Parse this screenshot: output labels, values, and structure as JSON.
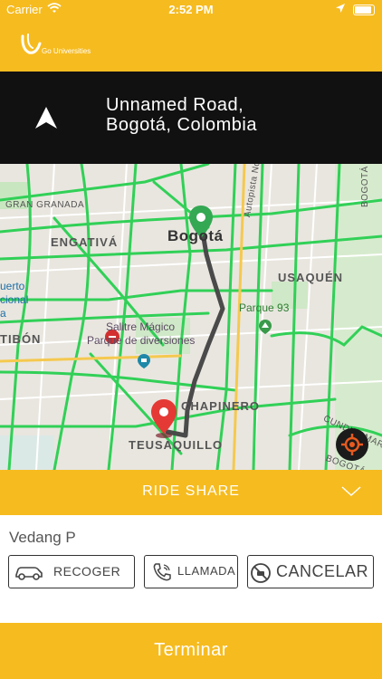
{
  "status_bar": {
    "carrier": "Carrier",
    "time": "2:52 PM"
  },
  "brand": {
    "logo_text": "Go Universities"
  },
  "navigation": {
    "direction_icon": "navigation-arrow-icon",
    "address_line1": "Unnamed Road,",
    "address_line2": "Bogotá, Colombia"
  },
  "map": {
    "labels": {
      "gran_granada": "GRAN GRANADA",
      "engativa": "ENGATIVÁ",
      "bogota": "Bogotá",
      "autopista": "Autopista Norte",
      "usaquen": "USAQUÉN",
      "parque93": "Parque 93",
      "puerto": "uerto",
      "nacional": "cional",
      "alto": "a",
      "tibon": "TIBÓN",
      "salitre1": "Salitre Mágico",
      "salitre2": "Parque de diversiones",
      "chapinero": "CHAPINERO",
      "teusaquillo": "TEUSAQUILLO",
      "bogota_side": "BOGOTÁ",
      "cundinamarca": "CUNDINAMAR",
      "bogota_bottom": "BOGOTÁ"
    }
  },
  "ride_share": {
    "title": "RIDE SHARE"
  },
  "driver": {
    "name": "Vedang P"
  },
  "actions": {
    "recoger": "RECOGER",
    "llamada": "LLAMADA",
    "cancelar": "CANCELAR"
  },
  "finish": {
    "label": "Terminar"
  },
  "colors": {
    "accent": "#f6bb1f",
    "nav_bg": "#111111",
    "route": "#3d3d3d",
    "origin_pin": "#34a853",
    "dest_pin": "#e53935",
    "traffic_green": "#31d057"
  }
}
